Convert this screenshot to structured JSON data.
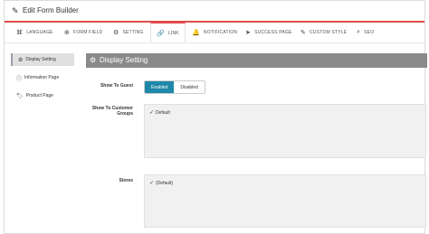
{
  "header": {
    "title": "Edit Form Builder"
  },
  "tabs": [
    {
      "label": "LANGUAGE",
      "icon": "language-icon"
    },
    {
      "label": "FORM FIELD",
      "icon": "plus-circle-icon"
    },
    {
      "label": "SETTING",
      "icon": "gears-icon"
    },
    {
      "label": "LINK",
      "icon": "link-icon",
      "active": true
    },
    {
      "label": "NOTIFICATION",
      "icon": "bell-icon"
    },
    {
      "label": "SUCCESS PAGE",
      "icon": "send-icon"
    },
    {
      "label": "CUSTOM STYLE",
      "icon": "brush-icon"
    },
    {
      "label": "SEO",
      "icon": "search-icon"
    }
  ],
  "sidebar": {
    "items": [
      {
        "label": "Display Setting",
        "icon": "gears-icon",
        "active": true
      },
      {
        "label": "Information Page",
        "icon": "info-icon"
      },
      {
        "label": "Product Page",
        "icon": "tag-icon"
      }
    ]
  },
  "panel": {
    "title": "Display Setting",
    "show_to_guest": {
      "label": "Show To Guest",
      "enabled": "Enabled",
      "disabled": "Disabled",
      "selected": "Enabled"
    },
    "customer_groups": {
      "label": "Show To Customer Groups",
      "options": [
        {
          "label": "Default",
          "checked": true
        }
      ]
    },
    "stores": {
      "label": "Stores",
      "options": [
        {
          "label": "(Default)",
          "checked": true
        }
      ]
    }
  },
  "colors": {
    "accent_red": "#e24b4b",
    "enabled_blue": "#1e88a8",
    "panel_gray": "#8a8a8a"
  }
}
